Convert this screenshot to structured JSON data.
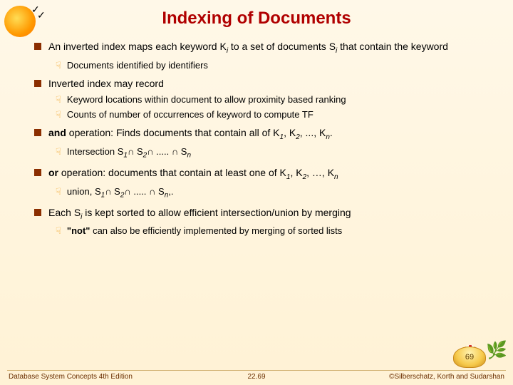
{
  "title": "Indexing of Documents",
  "bullets": {
    "b1": {
      "pre": "An inverted index maps each keyword ",
      "k": "K",
      "ki": "i",
      "mid": " to a set of documents ",
      "s": "S",
      "si": "i",
      "post": " that contain the keyword",
      "subs": {
        "s1": "Documents identified by identifiers"
      }
    },
    "b2": {
      "text": "Inverted index may record",
      "subs": {
        "s1": "Keyword locations within document to allow proximity based ranking",
        "s2": "Counts of number of occurrences of keyword to compute TF"
      }
    },
    "b3": {
      "op": "and",
      "pre": " operation: Finds documents that contain all of ",
      "k": "K",
      "k1": "1",
      "k2": "2",
      "kn": "n",
      "tail": ".",
      "subs": {
        "label": "Intersection ",
        "s": "S",
        "s1": "1",
        "s2": "2",
        "sn": "n",
        "cap": "∩",
        "dots": " ..... "
      }
    },
    "b4": {
      "op": "or",
      "pre": " operation: documents that contain at least one of  ",
      "k": "K",
      "k1": "1",
      "k2": "2",
      "kn": "n",
      "subs": {
        "label": "union, ",
        "s": "S",
        "s1": "1",
        "s2": "2",
        "sn": "n",
        "cap": "∩",
        "dots": " ..... ",
        "tail": ",."
      }
    },
    "b5": {
      "pre": "Each ",
      "s": "S",
      "si": "i",
      "post": " is kept sorted to allow efficient intersection/union by merging",
      "subs": {
        "q": "\"not\"",
        "rest": " can also be efficiently implemented by merging of sorted lists"
      }
    }
  },
  "footer": {
    "left": "Database System Concepts 4th Edition",
    "center": "22.69",
    "right": "©Silberschatz, Korth and Sudarshan"
  },
  "badge": "69"
}
